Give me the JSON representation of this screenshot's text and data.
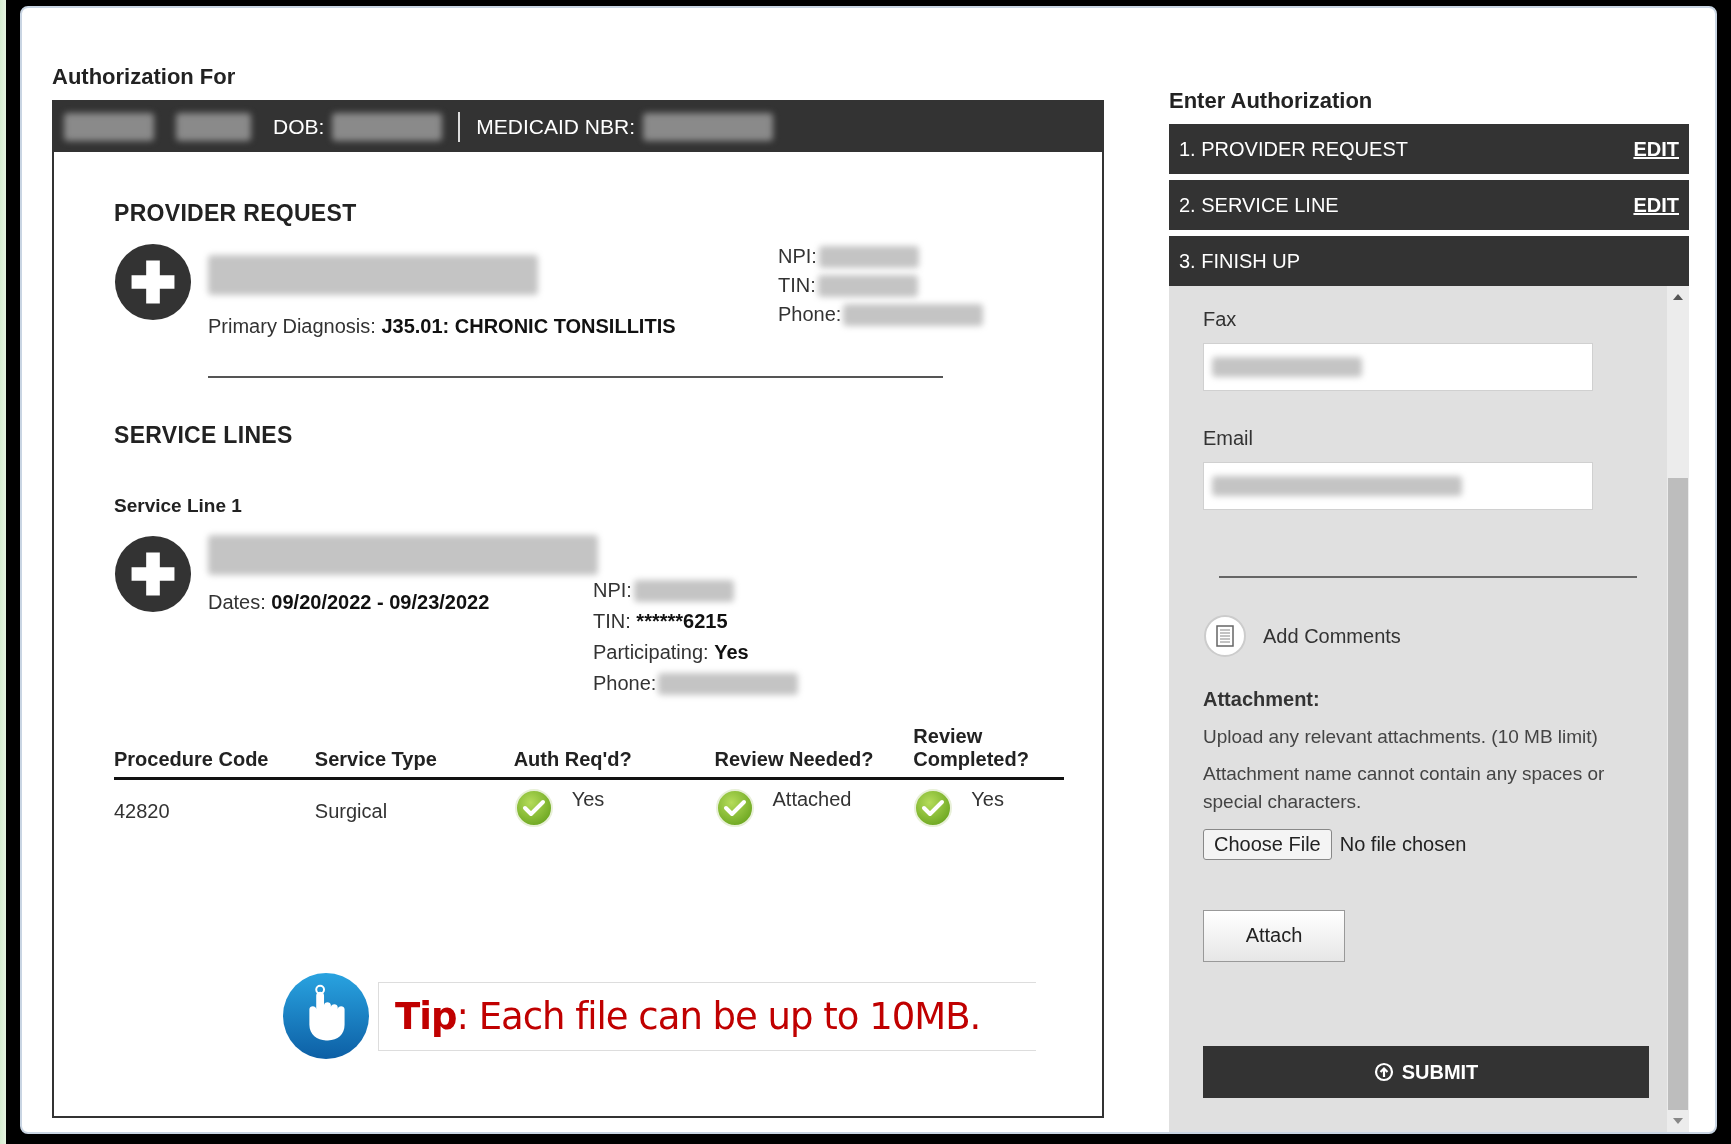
{
  "authorization_for": {
    "title": "Authorization For",
    "header": {
      "dob_label": "DOB:",
      "medicaid_label": "MEDICAID NBR:"
    },
    "provider_request": {
      "heading": "PROVIDER REQUEST",
      "diagnosis_label": "Primary Diagnosis:",
      "diagnosis_value": "J35.01: CHRONIC TONSILLITIS",
      "npi_label": "NPI:",
      "tin_label": "TIN:",
      "phone_label": "Phone:"
    },
    "service_lines": {
      "heading": "SERVICE LINES",
      "line_title": "Service Line 1",
      "dates_label": "Dates:",
      "dates_value": "09/20/2022 - 09/23/2022",
      "npi_label": "NPI:",
      "tin_label": "TIN:",
      "tin_value": "******6215",
      "participating_label": "Participating:",
      "participating_value": "Yes",
      "phone_label": "Phone:"
    },
    "table": {
      "columns": [
        "Procedure Code",
        "Service Type",
        "Auth Req'd?",
        "Review Needed?",
        "Review Completed?"
      ],
      "rows": [
        {
          "cells": [
            {
              "text": "42820",
              "checked": false
            },
            {
              "text": "Surgical",
              "checked": false
            },
            {
              "text": "Yes",
              "checked": true
            },
            {
              "text": "Attached",
              "checked": true
            },
            {
              "text": "Yes",
              "checked": true
            }
          ]
        }
      ]
    },
    "tip": "**Tip**: Each file can be up to 10MB."
  },
  "enter_authorization": {
    "title": "Enter Authorization",
    "steps": [
      {
        "label": "1. PROVIDER REQUEST",
        "action": "EDIT",
        "expanded": false
      },
      {
        "label": "2. SERVICE LINE",
        "action": "EDIT",
        "expanded": false
      },
      {
        "label": "3. FINISH UP",
        "expanded": true
      }
    ],
    "finish_up": {
      "fax_label": "Fax",
      "email_label": "Email",
      "add_comments": "Add Comments",
      "attachment_heading": "Attachment:",
      "upload_hint": "Upload any relevant attachments. (10 MB limit)",
      "name_hint": "Attachment name cannot contain any spaces or special characters.",
      "choose_file": "Choose File",
      "no_file": "No file chosen",
      "attach_button": "Attach",
      "submit_button": "SUBMIT"
    }
  }
}
